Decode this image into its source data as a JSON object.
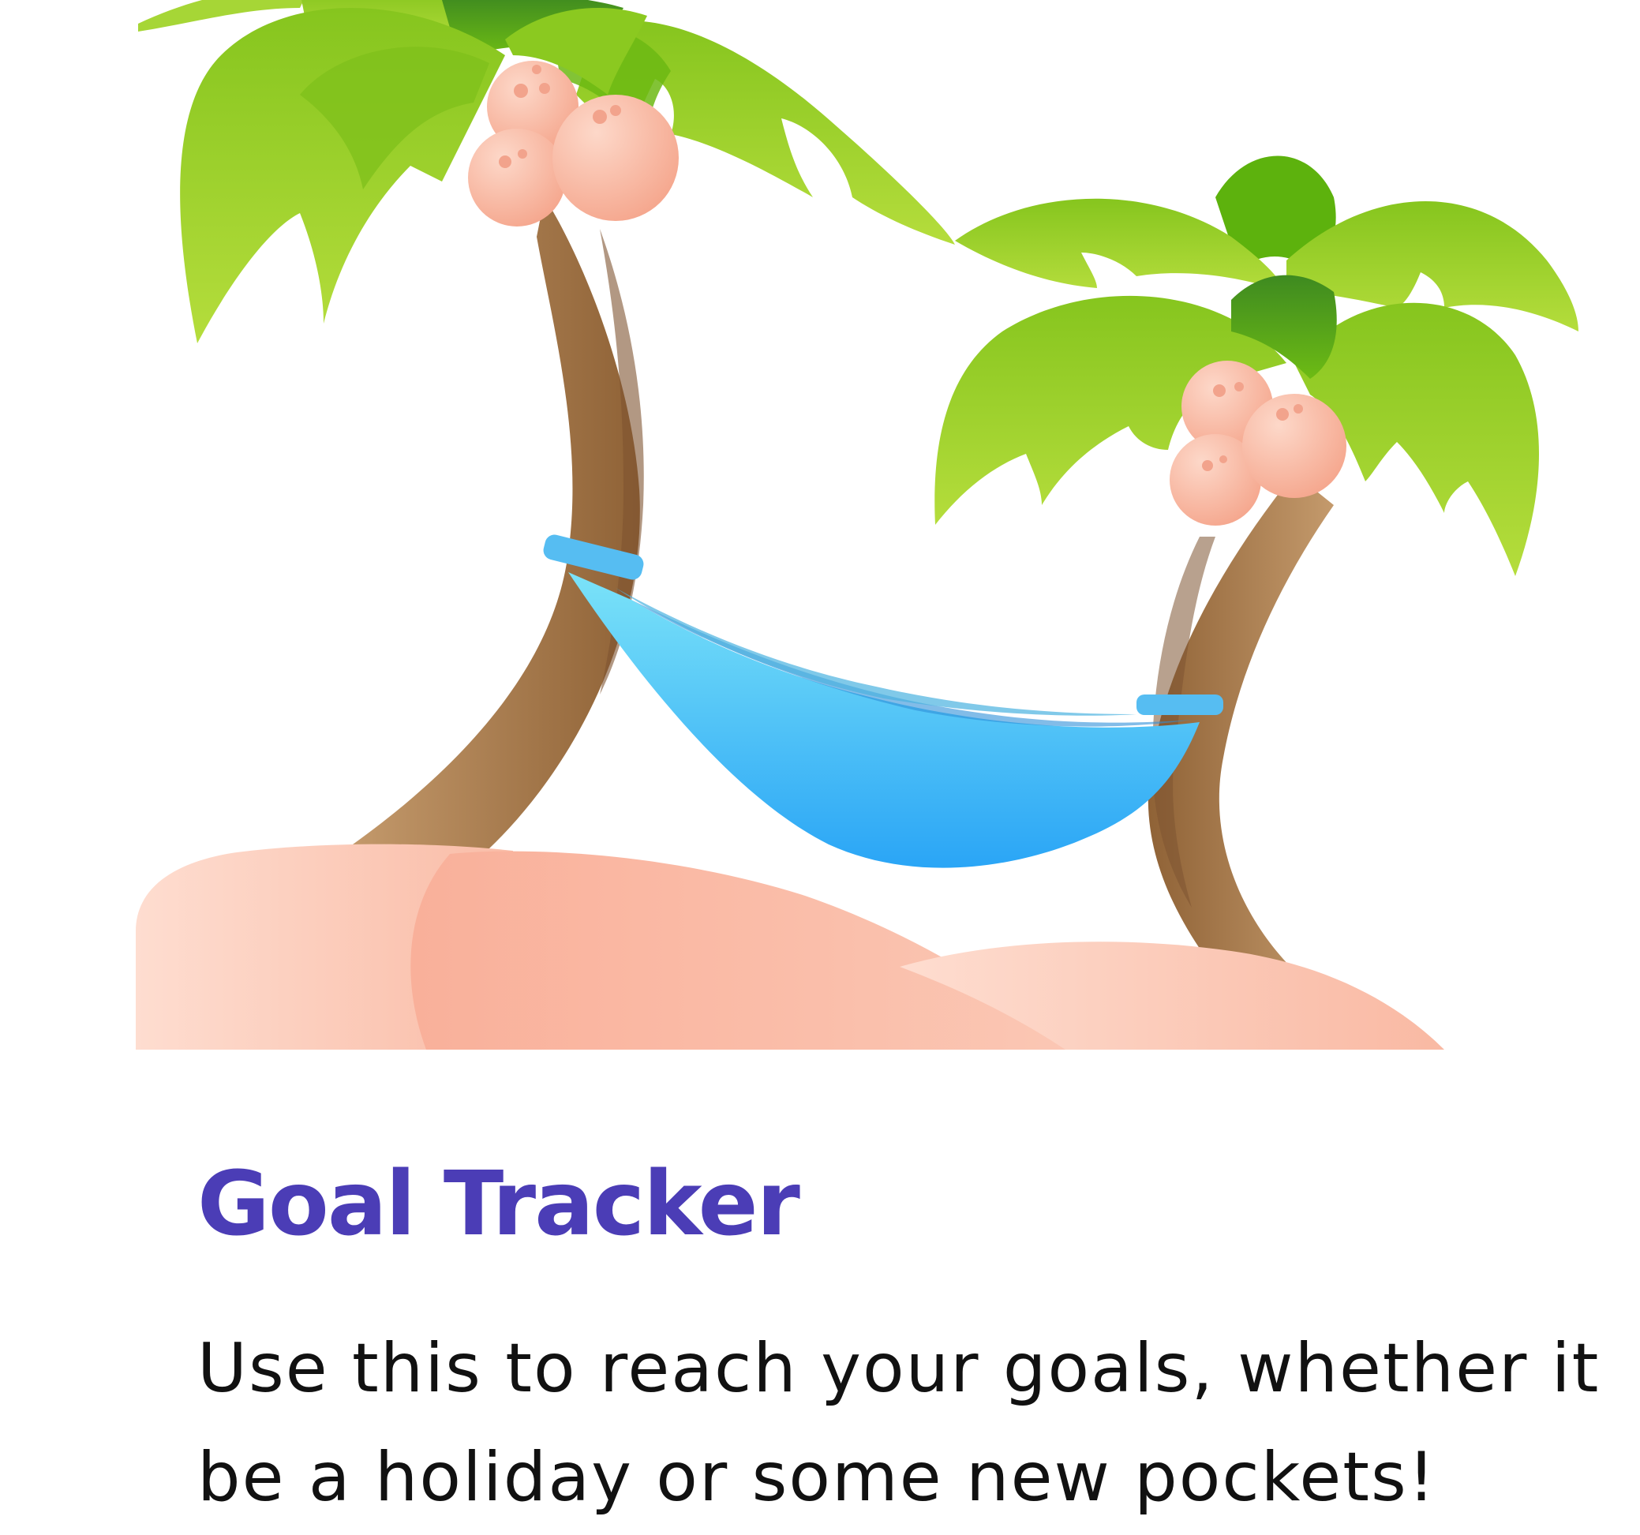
{
  "card": {
    "title": "Goal Tracker",
    "description": "Use this to reach your goals, whether it be a holiday or some new pockets!",
    "illustration_icon": "palm-trees-hammock-icon"
  },
  "colors": {
    "title": "#4B3DB6",
    "body_text": "#111111",
    "leaf_light": "#B2DC3A",
    "leaf_dark": "#5FB30D",
    "trunk": "#A87B50",
    "coconut": "#F9B7A0",
    "hammock": "#3BB6F5",
    "sand": "#FDD5C6"
  }
}
